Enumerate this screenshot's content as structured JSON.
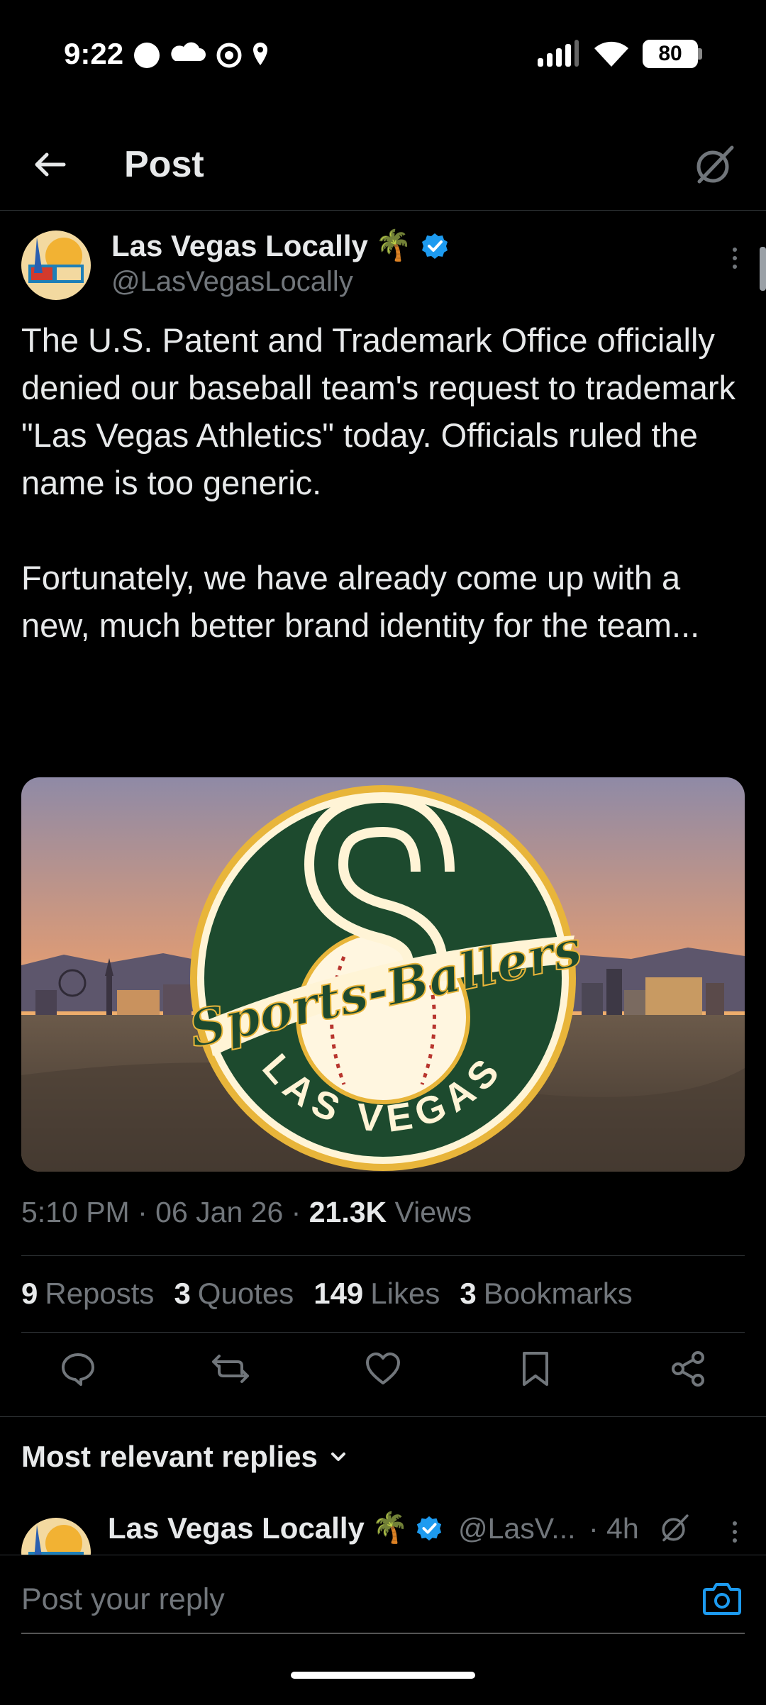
{
  "status_bar": {
    "time": "9:22",
    "battery": "80"
  },
  "header": {
    "title": "Post"
  },
  "post": {
    "author_name": "Las Vegas Locally",
    "author_emoji": "🌴",
    "handle": "@LasVegasLocally",
    "text": "The U.S. Patent and Trademark Office officially denied our baseball team's request to trademark \"Las Vegas Athletics\" today. Officials ruled the name is too generic.\n\nFortunately, we have already come up with a new, much better brand identity for the team...",
    "media": {
      "logo_script": "Sports-Ballers",
      "logo_ring_text": "LAS VEGAS",
      "logo_letter": "S"
    },
    "time": "5:10 PM",
    "date": "06 Jan 26",
    "views_count": "21.3K",
    "views_label": "Views",
    "stats": [
      {
        "count": "9",
        "label": "Reposts"
      },
      {
        "count": "3",
        "label": "Quotes"
      },
      {
        "count": "149",
        "label": "Likes"
      },
      {
        "count": "3",
        "label": "Bookmarks"
      }
    ]
  },
  "replies": {
    "sort_label": "Most relevant replies",
    "first": {
      "author_name": "Las Vegas Locally",
      "author_emoji": "🌴",
      "handle": "@LasV...",
      "time": "· 4h"
    }
  },
  "composer": {
    "placeholder": "Post your reply"
  },
  "colors": {
    "background": "#000000",
    "text": "#e7e9ea",
    "muted": "#71767b",
    "verified": "#1d9bf0",
    "divider": "#2f3336",
    "team_green": "#1d4a2e",
    "team_gold": "#e8b53a"
  },
  "icons": [
    "back-arrow-icon",
    "grok-icon",
    "more-icon",
    "verified-icon",
    "reply-icon",
    "repost-icon",
    "like-icon",
    "bookmark-icon",
    "share-icon",
    "chevron-down-icon",
    "camera-icon"
  ]
}
